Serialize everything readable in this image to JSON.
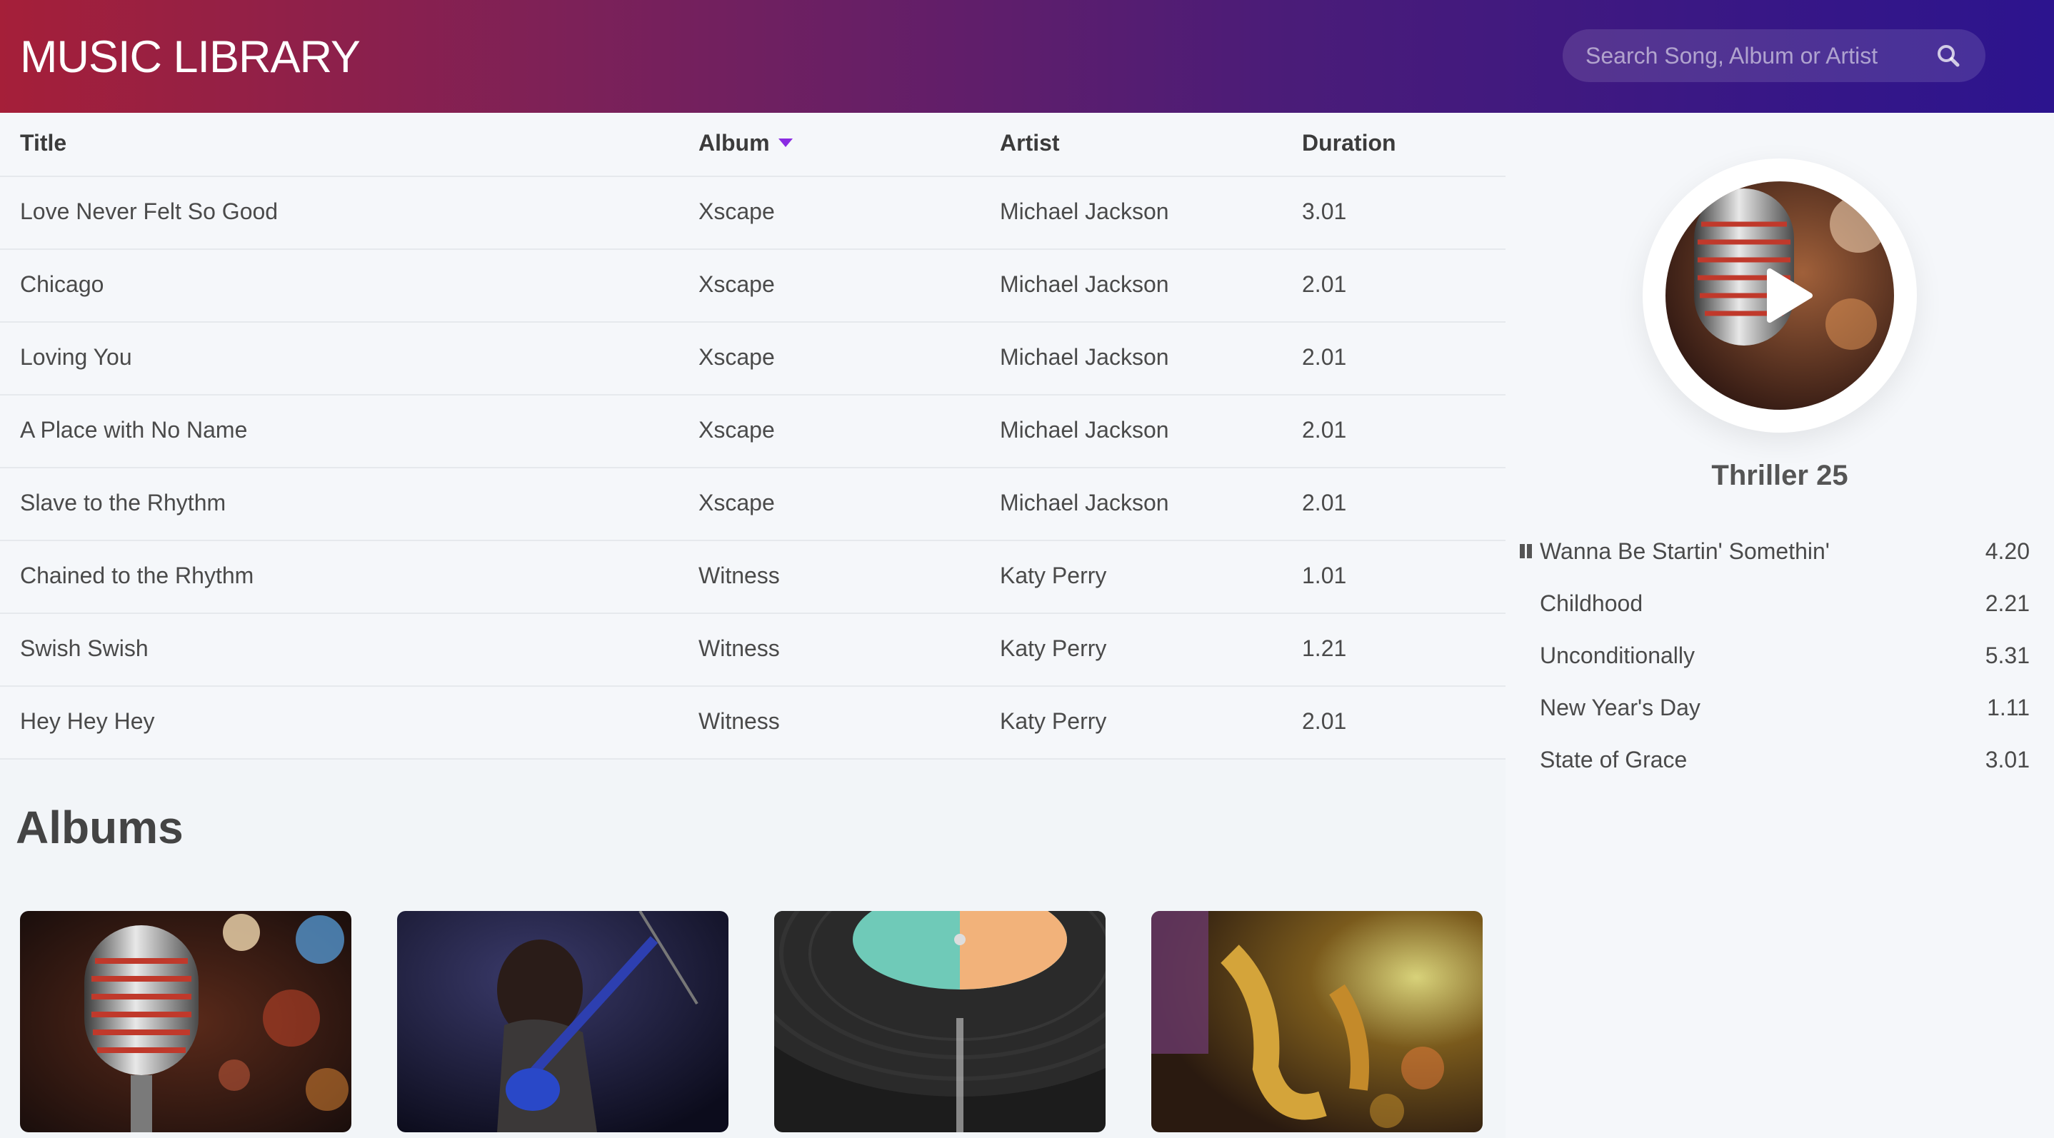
{
  "header": {
    "title": "MUSIC LIBRARY",
    "search_placeholder": "Search Song, Album or Artist",
    "search_value": "",
    "search_icon": "search-icon",
    "gradient_colors": [
      "#a51f39",
      "#7c2158",
      "#4b1c78",
      "#2c148e"
    ]
  },
  "table": {
    "columns": [
      "Title",
      "Album",
      "Artist",
      "Duration"
    ],
    "sorted_column": "Album",
    "accent_color": "#8a2be2",
    "rows": [
      {
        "title": "Love Never Felt So Good",
        "album": "Xscape",
        "artist": "Michael Jackson",
        "duration": "3.01"
      },
      {
        "title": "Chicago",
        "album": "Xscape",
        "artist": "Michael Jackson",
        "duration": "2.01"
      },
      {
        "title": "Loving You",
        "album": "Xscape",
        "artist": "Michael Jackson",
        "duration": "2.01"
      },
      {
        "title": "A Place with No Name",
        "album": "Xscape",
        "artist": "Michael Jackson",
        "duration": "2.01"
      },
      {
        "title": "Slave to the Rhythm",
        "album": "Xscape",
        "artist": "Michael Jackson",
        "duration": "2.01"
      },
      {
        "title": "Chained to the Rhythm",
        "album": "Witness",
        "artist": "Katy Perry",
        "duration": "1.01"
      },
      {
        "title": "Swish Swish",
        "album": "Witness",
        "artist": "Katy Perry",
        "duration": "1.21"
      },
      {
        "title": "Hey Hey Hey",
        "album": "Witness",
        "artist": "Katy Perry",
        "duration": "2.01"
      }
    ]
  },
  "albums": {
    "heading": "Albums",
    "items": [
      {
        "image": "vintage-microphone-image"
      },
      {
        "image": "guitarist-concert-image"
      },
      {
        "image": "vinyl-record-image"
      },
      {
        "image": "saxophone-band-image"
      }
    ]
  },
  "now_playing": {
    "album": "Thriller 25",
    "cover_image": "vintage-microphone-image",
    "play_icon": "play-icon",
    "pause_icon": "pause-icon",
    "tracks": [
      {
        "name": "Wanna Be Startin' Somethin'",
        "duration": "4.20",
        "playing": true
      },
      {
        "name": "Childhood",
        "duration": "2.21",
        "playing": false
      },
      {
        "name": "Unconditionally",
        "duration": "5.31",
        "playing": false
      },
      {
        "name": "New Year's Day",
        "duration": "1.11",
        "playing": false
      },
      {
        "name": "State of Grace",
        "duration": "3.01",
        "playing": false
      }
    ]
  }
}
